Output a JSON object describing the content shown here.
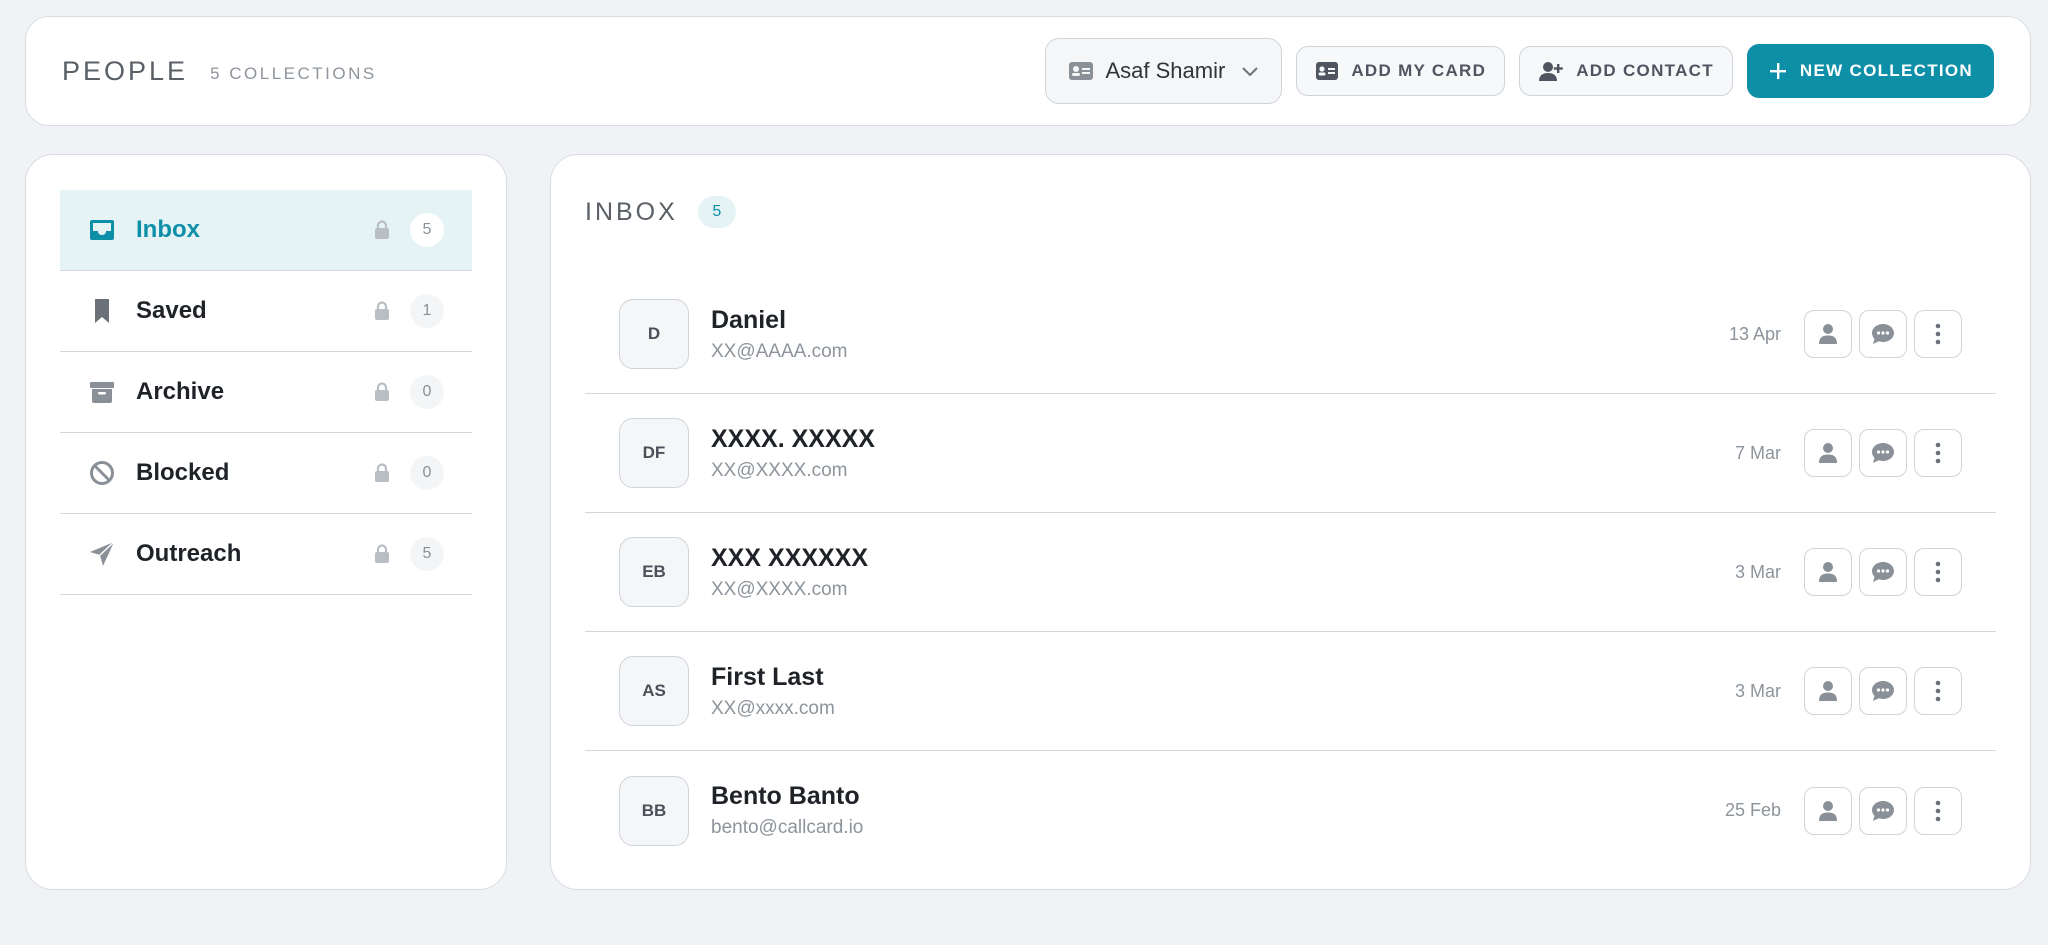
{
  "header": {
    "title": "PEOPLE",
    "subtitle": "5 COLLECTIONS",
    "account_name": "Asaf Shamir",
    "add_my_card_label": "ADD MY CARD",
    "add_contact_label": "ADD CONTACT",
    "new_collection_label": "NEW COLLECTION"
  },
  "sidebar": {
    "items": [
      {
        "label": "Inbox",
        "count": "5",
        "icon": "inbox-icon",
        "active": true
      },
      {
        "label": "Saved",
        "count": "1",
        "icon": "bookmark-icon",
        "active": false
      },
      {
        "label": "Archive",
        "count": "0",
        "icon": "archive-icon",
        "active": false
      },
      {
        "label": "Blocked",
        "count": "0",
        "icon": "blocked-icon",
        "active": false
      },
      {
        "label": "Outreach",
        "count": "5",
        "icon": "send-icon",
        "active": false
      }
    ]
  },
  "main": {
    "title": "INBOX",
    "count": "5",
    "contacts": [
      {
        "initials": "D",
        "name": "Daniel",
        "email": "XX@AAAA.com",
        "date": "13 Apr"
      },
      {
        "initials": "DF",
        "name": "XXXX.  XXXXX",
        "email": "XX@XXXX.com",
        "date": "7 Mar"
      },
      {
        "initials": "EB",
        "name": "XXX XXXXXX",
        "email": "XX@XXXX.com",
        "date": "3 Mar"
      },
      {
        "initials": "AS",
        "name": "First Last",
        "email": "XX@xxxx.com",
        "date": "3 Mar"
      },
      {
        "initials": "BB",
        "name": "Bento Banto",
        "email": "bento@callcard.io",
        "date": "25 Feb"
      }
    ]
  },
  "colors": {
    "accent": "#0e8fa8",
    "active_bg": "#e6f3f5",
    "page_bg": "#f0f2f5",
    "icon_gray": "#9aa0a7"
  }
}
